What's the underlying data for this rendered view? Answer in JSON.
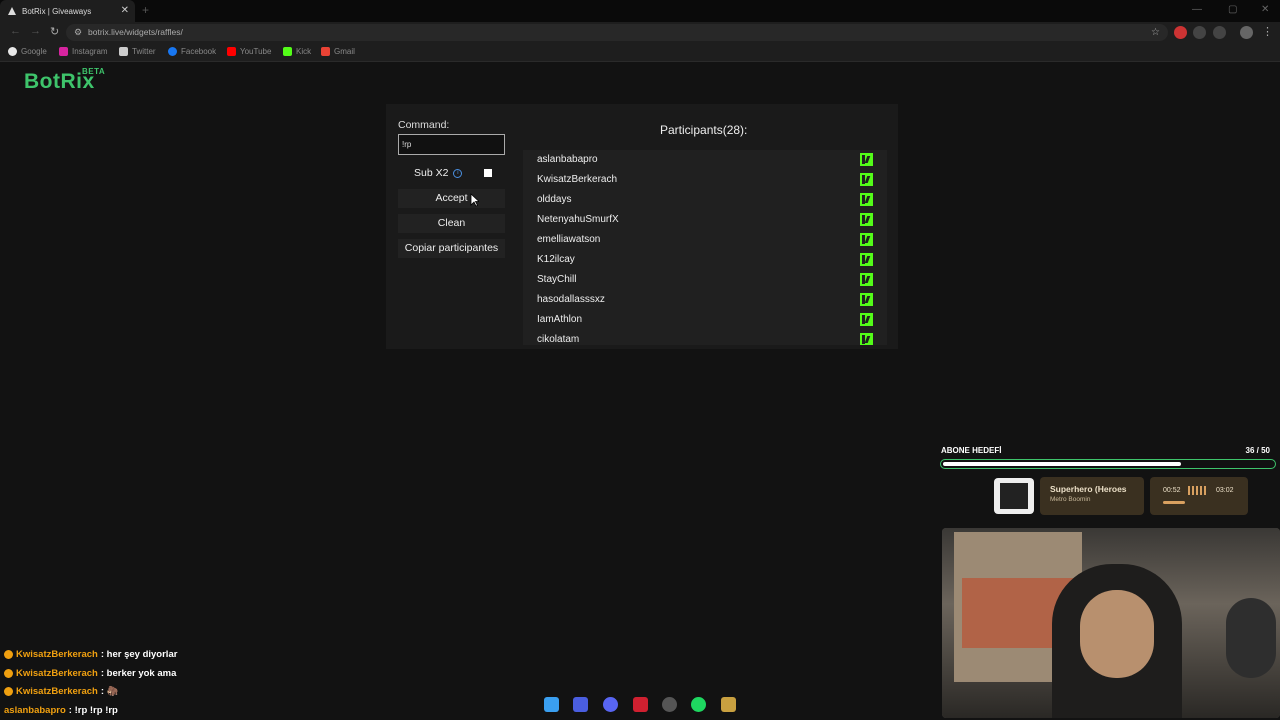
{
  "browser": {
    "tab_title": "BotRix | Giveaways",
    "tab_close": "✕",
    "new_tab": "+",
    "url": "botrix.live/widgets/raffles/",
    "window_controls": [
      "—",
      "▢",
      "✕"
    ],
    "bookmarks": [
      {
        "label": "Google",
        "color": "#e8e8e8"
      },
      {
        "label": "Instagram",
        "color": "#d6249f"
      },
      {
        "label": "Twitter",
        "color": "#cccccc"
      },
      {
        "label": "Facebook",
        "color": "#1877f2"
      },
      {
        "label": "YouTube",
        "color": "#ff0000"
      },
      {
        "label": "Kick",
        "color": "#53fc18"
      },
      {
        "label": "Gmail",
        "color": "#ea4335"
      }
    ]
  },
  "brand": {
    "name": "BotRix",
    "badge": "BETA",
    "color": "#3ec46b"
  },
  "raffle": {
    "command_label": "Command:",
    "command_value": "!rp",
    "sub_label": "Sub X2",
    "sub_checked": false,
    "accept_label": "Accept",
    "clean_label": "Clean",
    "copy_label": "Copiar participantes",
    "participants_title": "Participants(28):",
    "participants": [
      "aslanbabapro",
      "KwisatzBerkerach",
      "olddays",
      "NetenyahuSmurfX",
      "emelliawatson",
      "K12ilcay",
      "StayChill",
      "hasodallasssxz",
      "IamAthlon",
      "cikolatam"
    ],
    "platform_icon": "kick-icon"
  },
  "overlay": {
    "goal_title": "ABONE HEDEFİ",
    "goal_current": 36,
    "goal_total": 50,
    "goal_count_text": "36  / 50",
    "now_playing_title": "Superhero (Heroes",
    "now_playing_artist": "Metro Boomin",
    "elapsed": "00:52",
    "duration": "03:02"
  },
  "chat": [
    {
      "user": "KwisatzBerkerach",
      "message": ": her şey diyorlar",
      "badge": true
    },
    {
      "user": "KwisatzBerkerach",
      "message": ": berker yok ama",
      "badge": true
    },
    {
      "user": "KwisatzBerkerach",
      "message": ": 🦣",
      "badge": true
    },
    {
      "user": "aslanbabapro",
      "message": ": !rp !rp !rp",
      "badge": false
    }
  ],
  "taskbar_icons": [
    "windows-icon",
    "app-icon",
    "discord-icon",
    "app-red-icon",
    "chatgpt-icon",
    "spotify-icon",
    "league-icon"
  ]
}
